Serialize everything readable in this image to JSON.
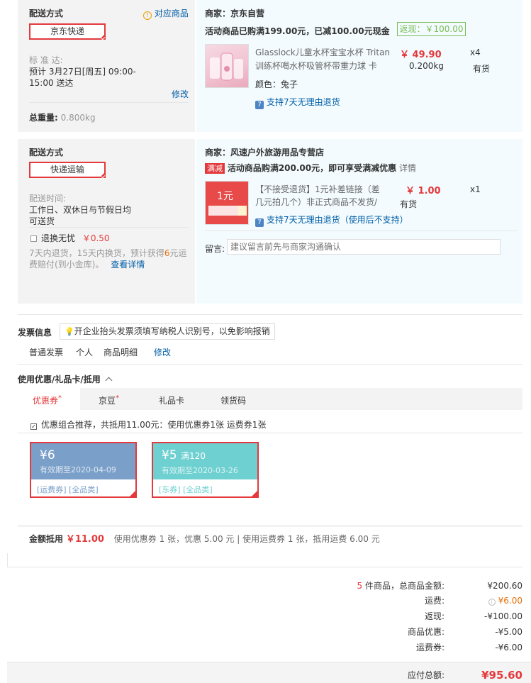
{
  "blocks": [
    {
      "ship_title": "配送方式",
      "ship_method": "京东快递",
      "corr_goods": "对应商品",
      "delivery_label": "标 准 达:",
      "delivery_line1": "预计 3月27日[周五] 09:00-",
      "delivery_line2": "15:00 送达",
      "modify": "修改",
      "weight_label": "总重量:",
      "weight_value": "0.800kg",
      "merchant": "商家：京东自营",
      "promo": "活动商品已购满199.00元，已减100.00元现金",
      "rebate": "返现：￥100.00",
      "product_name_1": "Glasslock儿童水杯宝宝水杯 Tritan",
      "product_name_2": "训练杯喝水杯吸管杯带重力球 卡",
      "price": "￥ 49.90",
      "qty": "x4",
      "weight": "0.200kg",
      "stock": "有货",
      "color": "颜色：兔子",
      "return_policy": "支持7天无理由退货"
    },
    {
      "ship_title": "配送方式",
      "ship_method": "快递运输",
      "delivery_label": "配送时间:",
      "delivery_line1": "工作日、双休日与节假日均",
      "delivery_line2": "可送货",
      "insurance_label": "退换无忧",
      "insurance_price": "￥0.50",
      "insurance_desc_1a": "7天内退货，15天内换货，预计获得",
      "insurance_desc_num": "6",
      "insurance_desc_1b": "元运",
      "insurance_desc_2": "费赔付(到小金库)。",
      "insurance_link": "查看详情",
      "merchant": "商家：风速户外旅游用品专营店",
      "promo_tag": "满减",
      "promo": "活动商品购满200.00元，即可享受满减优惠",
      "promo_detail": "详情",
      "product_img_text": "1元",
      "product_name_1": "【不接受退货】1元补差链接（差",
      "product_name_2": "几元拍几个）非正式商品不发货/",
      "price": "￥ 1.00",
      "qty": "x1",
      "stock": "有货",
      "return_policy": "支持7天无理由退货（使用后不支持）",
      "message_label": "留言:",
      "message_placeholder": "建议留言前先与商家沟通确认"
    }
  ],
  "invoice": {
    "title": "发票信息",
    "tip": "开企业抬头发票须填写纳税人识别号，以免影响报销",
    "type": "普通发票",
    "personal": "个人",
    "detail": "商品明细",
    "modify": "修改"
  },
  "coupon_section": {
    "title": "使用优惠/礼品卡/抵用",
    "tabs": [
      "优惠券",
      "京豆",
      "礼品卡",
      "领货码"
    ],
    "recommend": "优惠组合推荐，共抵用11.00元：使用优惠券1张 运费券1张",
    "coupons": [
      {
        "amount": "¥6",
        "threshold": "",
        "expiry": "有效期至2020-04-09",
        "tags": "[运费券] [全品类]",
        "color": "#7a9fc9"
      },
      {
        "amount": "¥5",
        "threshold": "满120",
        "expiry": "有效期至2020-03-26",
        "tags": "[东券] [全品类]",
        "color": "#6fd0d1"
      }
    ],
    "deduct_label": "金额抵用",
    "deduct_amount": "￥11.00",
    "deduct_desc": "使用优惠券 1 张，优惠 5.00 元 | 使用运费券 1 张，抵用运费 6.00 元"
  },
  "summary": {
    "count": "5",
    "count_label": "件商品，总商品金额:",
    "total": "¥200.60",
    "freight_label": "运费:",
    "freight": "¥6.00",
    "rebate_label": "返现:",
    "rebate": "-¥100.00",
    "discount_label": "商品优惠:",
    "discount": "-¥5.00",
    "freight_coupon_label": "运费券:",
    "freight_coupon": "-¥6.00",
    "pay_label": "应付总额:",
    "pay": "¥95.60"
  }
}
